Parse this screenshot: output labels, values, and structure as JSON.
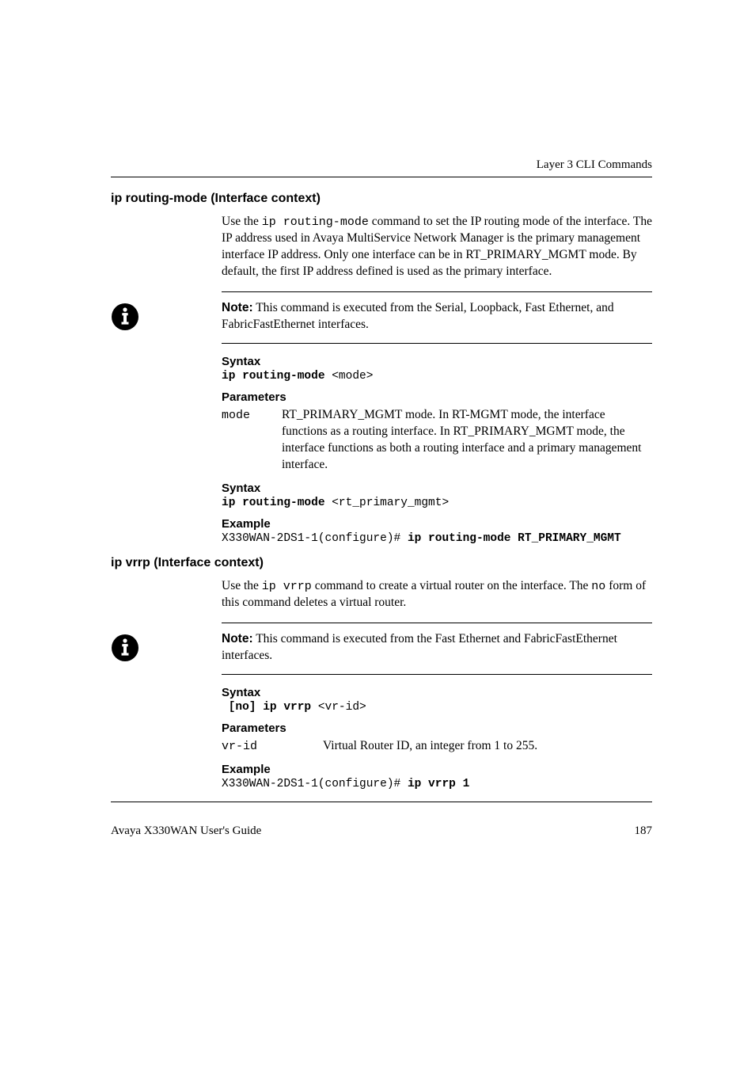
{
  "header": {
    "chapter": "Layer 3 CLI Commands"
  },
  "section1": {
    "title": "ip routing-mode (Interface context)",
    "intro_pre": "Use the ",
    "intro_cmd": "ip routing-mode",
    "intro_post": " command to set the IP routing mode of the interface. The IP address used in Avaya MultiService Network Manager is the primary management interface IP address. Only one interface can be in RT_PRIMARY_MGMT mode. By default, the first IP address defined is used as the primary interface.",
    "note_label": "Note:",
    "note_text": "  This command is executed from the Serial, Loopback, Fast Ethernet, and FabricFastEthernet interfaces.",
    "syntax1_head": "Syntax",
    "syntax1_bold": "ip routing-mode ",
    "syntax1_arg": "<mode>",
    "params_head": "Parameters",
    "param_name": "mode",
    "param_desc": "RT_PRIMARY_MGMT mode. In RT-MGMT mode, the interface functions as a routing interface. In RT_PRIMARY_MGMT mode, the interface functions as both a routing interface and a primary management interface.",
    "syntax2_head": "Syntax",
    "syntax2_bold": "ip routing-mode ",
    "syntax2_arg": "<rt_primary_mgmt>",
    "example_head": "Example",
    "example_pre": "X330WAN-2DS1-1(configure)# ",
    "example_bold": "ip routing-mode RT_PRIMARY_MGMT"
  },
  "section2": {
    "title": "ip vrrp (Interface context)",
    "intro_pre": "Use the ",
    "intro_cmd": "ip vrrp",
    "intro_mid": " command to create a virtual router on the interface. The ",
    "intro_no": "no",
    "intro_post": " form of this command deletes a virtual router.",
    "note_label": "Note:",
    "note_text": "  This command is executed from the Fast Ethernet and FabricFastEthernet interfaces.",
    "syntax_head": "Syntax",
    "syntax_bold": " [no] ip vrrp ",
    "syntax_arg": "<vr-id>",
    "params_head": "Parameters",
    "param_name": "vr-id",
    "param_desc": "Virtual Router ID, an integer from 1 to 255.",
    "example_head": "Example",
    "example_pre": "X330WAN-2DS1-1(configure)# ",
    "example_bold": "ip vrrp 1"
  },
  "footer": {
    "left": "Avaya X330WAN User's Guide",
    "right": "187"
  }
}
